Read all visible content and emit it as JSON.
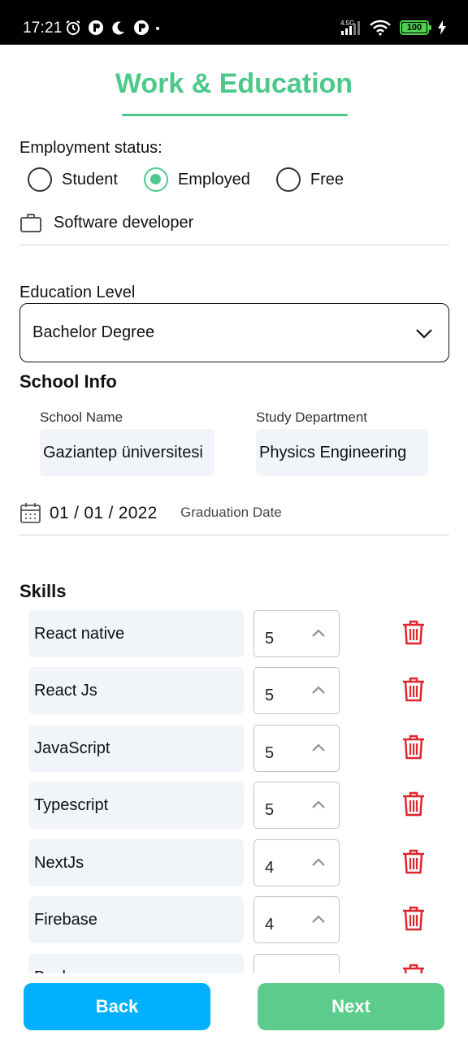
{
  "status_bar": {
    "time": "17:21",
    "network_label": "4.5G",
    "battery": "100"
  },
  "header": {
    "title": "Work & Education"
  },
  "employment": {
    "label": "Employment status:",
    "options": [
      "Student",
      "Employed",
      "Free"
    ],
    "selected": "Employed",
    "job_title": "Software developer"
  },
  "education": {
    "label": "Education Level",
    "selected": "Bachelor Degree"
  },
  "school": {
    "section_title": "School Info",
    "name_label": "School Name",
    "name_value": "Gaziantep üniversitesi",
    "department_label": "Study Department",
    "department_value": "Physics Engineering",
    "graduation_date": "01 / 01 / 2022",
    "graduation_label": "Graduation Date"
  },
  "skills": {
    "section_title": "Skills",
    "items": [
      {
        "name": "React native",
        "level": "5"
      },
      {
        "name": "React Js",
        "level": "5"
      },
      {
        "name": "JavaScript",
        "level": "5"
      },
      {
        "name": "Typescript",
        "level": "5"
      },
      {
        "name": "NextJs",
        "level": "4"
      },
      {
        "name": "Firebase",
        "level": "4"
      },
      {
        "name": "Backe...",
        "level": ""
      }
    ]
  },
  "footer": {
    "back_label": "Back",
    "next_label": "Next"
  },
  "colors": {
    "accent": "#4cc98a",
    "back_button": "#00b0ff",
    "next_button": "#5bcc8c",
    "delete_icon": "#e0262d",
    "input_background": "#f1f5f9"
  }
}
